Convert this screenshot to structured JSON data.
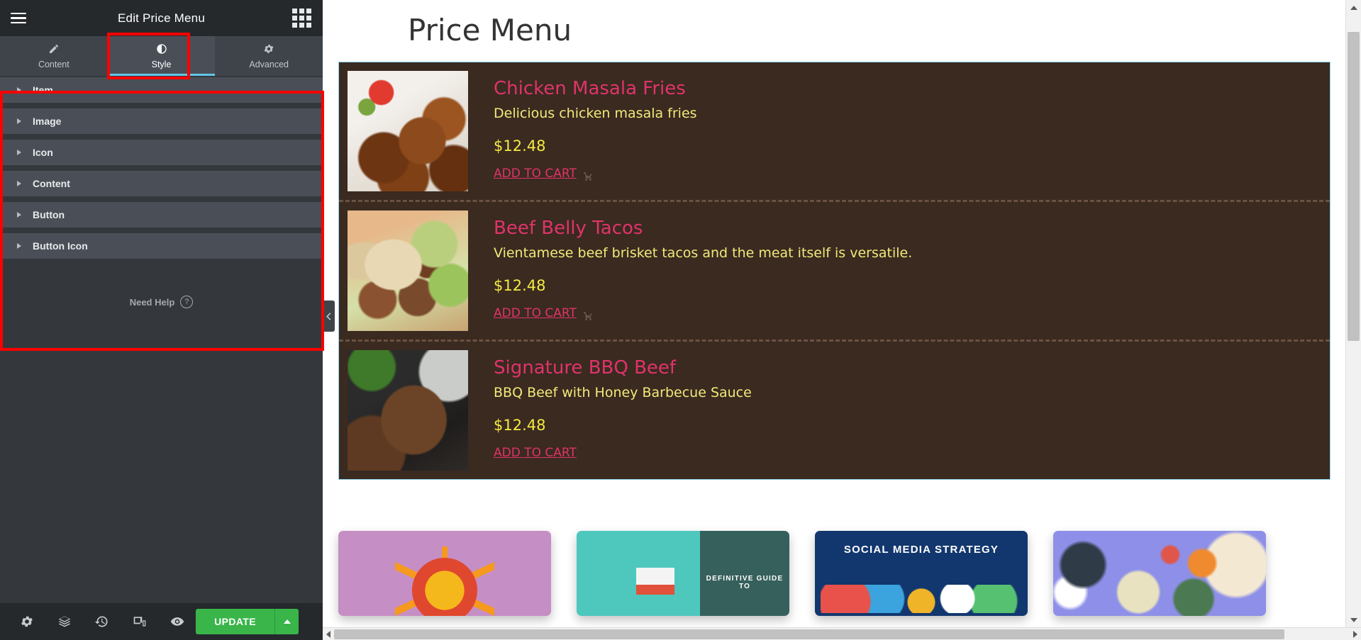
{
  "panel": {
    "title": "Edit Price Menu",
    "menu_icon": "hamburger-icon",
    "widgets_icon": "widgets-grid-icon",
    "tabs": [
      {
        "label": "Content",
        "icon": "pencil-icon",
        "active": false
      },
      {
        "label": "Style",
        "icon": "contrast-half-circle-icon",
        "active": true
      },
      {
        "label": "Advanced",
        "icon": "gear-icon",
        "active": false
      }
    ],
    "sections": [
      {
        "label": "Item"
      },
      {
        "label": "Image"
      },
      {
        "label": "Icon"
      },
      {
        "label": "Content"
      },
      {
        "label": "Button"
      },
      {
        "label": "Button Icon"
      }
    ],
    "need_help": "Need Help",
    "need_help_icon": "question-mark-circle-icon",
    "footer": {
      "icons": [
        {
          "name": "settings-gear-icon"
        },
        {
          "name": "navigator-layers-icon"
        },
        {
          "name": "history-clock-icon"
        },
        {
          "name": "responsive-mode-icon"
        },
        {
          "name": "preview-eye-icon"
        }
      ],
      "update_label": "UPDATE",
      "update_caret_icon": "caret-up-icon"
    },
    "collapse_icon": "chevron-left-icon"
  },
  "annotations": {
    "highlight_color": "#ff0000",
    "style_tab_box": "Style tab highlighted",
    "sections_box": "Style sections list highlighted"
  },
  "canvas": {
    "page_title": "Price Menu",
    "menu_items": [
      {
        "title": "Chicken Masala Fries",
        "description": "Delicious chicken masala fries",
        "price": "$12.48",
        "button_label": "ADD TO CART",
        "has_cart_icon": true,
        "thumb_class": "thumb-chicken"
      },
      {
        "title": "Beef Belly Tacos",
        "description": "Vientamese beef brisket tacos and the meat itself is versatile.",
        "price": "$12.48",
        "button_label": "ADD TO CART",
        "has_cart_icon": true,
        "thumb_class": "thumb-tacos"
      },
      {
        "title": "Signature BBQ Beef",
        "description": "BBQ Beef with Honey Barbecue Sauce",
        "price": "$12.48",
        "button_label": "ADD TO CART",
        "has_cart_icon": false,
        "thumb_class": "thumb-steak"
      }
    ],
    "promo_cards": [
      {
        "label": "",
        "klass": "pc1",
        "color": "#c58ec4"
      },
      {
        "label": "DEFINITIVE GUIDE TO",
        "klass": "pc2",
        "color": "#4ec7bd"
      },
      {
        "label": "SOCIAL MEDIA STRATEGY",
        "klass": "pc3",
        "color": "#12376e"
      },
      {
        "label": "",
        "klass": "pc4",
        "color": "#8e8fe8"
      }
    ]
  },
  "colors": {
    "accent_blue": "#63c5e8",
    "update_green": "#39b54a",
    "menu_bg": "#3a2a20",
    "item_title": "#e0336b",
    "item_desc": "#f2e97a",
    "item_price": "#f5e942",
    "highlight": "#ff0000"
  }
}
